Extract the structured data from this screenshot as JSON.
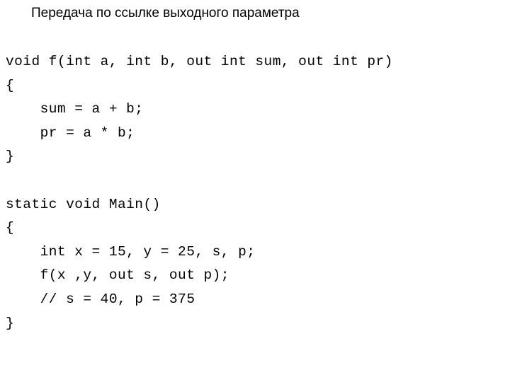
{
  "slide": {
    "title": "Передача по ссылке выходного параметра",
    "background_color": "#ffffff",
    "text_color": "#000000"
  },
  "code": {
    "language": "csharp",
    "lines": [
      "void f(int a, int b, out int sum, out int pr)",
      "{",
      "    sum = a + b;",
      "    pr = a * b;",
      "}",
      "",
      "static void Main()",
      "{",
      "    int x = 15, y = 25, s, p;",
      "    f(x ,y, out s, out p);",
      "    // s = 40, p = 375",
      "}"
    ]
  }
}
